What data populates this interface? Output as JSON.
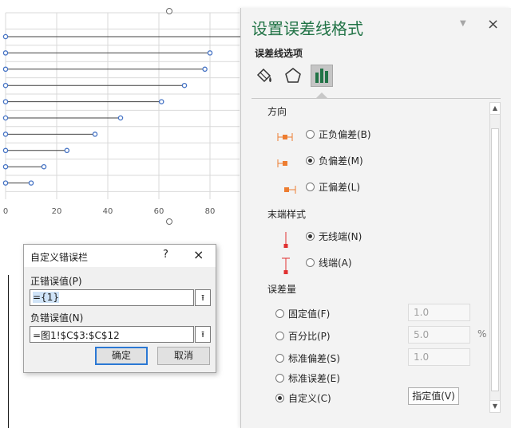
{
  "chart": {
    "x_ticks": [
      "0",
      "20",
      "40",
      "60",
      "80"
    ],
    "chart_data": {
      "type": "scatter",
      "title": "",
      "xlabel": "",
      "ylabel": "",
      "xlim": [
        0,
        92
      ],
      "grid": true,
      "points_x": [
        10,
        15,
        24,
        35,
        45,
        61,
        70,
        78,
        80,
        100
      ],
      "marker_color": "#4472c4",
      "error_bar_color": "#404040"
    }
  },
  "pane": {
    "title": "设置误差线格式",
    "dropdown_icon": "chevron-down-icon",
    "close_label": "×",
    "subtitle": "误差线选项",
    "tabs": [
      {
        "name": "fill-line",
        "icon": "paint-bucket-icon"
      },
      {
        "name": "effects",
        "icon": "pentagon-icon"
      },
      {
        "name": "error-bar-options",
        "icon": "bar-chart-icon",
        "selected": true
      }
    ],
    "direction": {
      "heading": "方向",
      "options": [
        {
          "label": "正负偏差(B)",
          "selected": false
        },
        {
          "label": "负偏差(M)",
          "selected": true
        },
        {
          "label": "正偏差(L)",
          "selected": false
        }
      ]
    },
    "end_style": {
      "heading": "末端样式",
      "options": [
        {
          "label": "无线端(N)",
          "selected": true
        },
        {
          "label": "线端(A)",
          "selected": false
        }
      ]
    },
    "amount": {
      "heading": "误差量",
      "options": [
        {
          "label": "固定值(F)",
          "selected": false,
          "value": "1.0"
        },
        {
          "label": "百分比(P)",
          "selected": false,
          "value": "5.0",
          "unit": "%"
        },
        {
          "label": "标准偏差(S)",
          "selected": false,
          "value": "1.0"
        },
        {
          "label": "标准误差(E)",
          "selected": false
        },
        {
          "label": "自定义(C)",
          "selected": true
        }
      ],
      "specify_button": "指定值(V)"
    },
    "colors": {
      "accent": "#217346",
      "glyph_orange": "#ed7d31",
      "glyph_red": "#e03030"
    }
  },
  "dialog": {
    "title": "自定义错误栏",
    "help": "?",
    "close": "×",
    "positive_label": "正错误值(P)",
    "positive_value": "={1}",
    "negative_label": "负错误值(N)",
    "negative_value": "=图1!$C$3:$C$12",
    "ok": "确定",
    "cancel": "取消"
  }
}
